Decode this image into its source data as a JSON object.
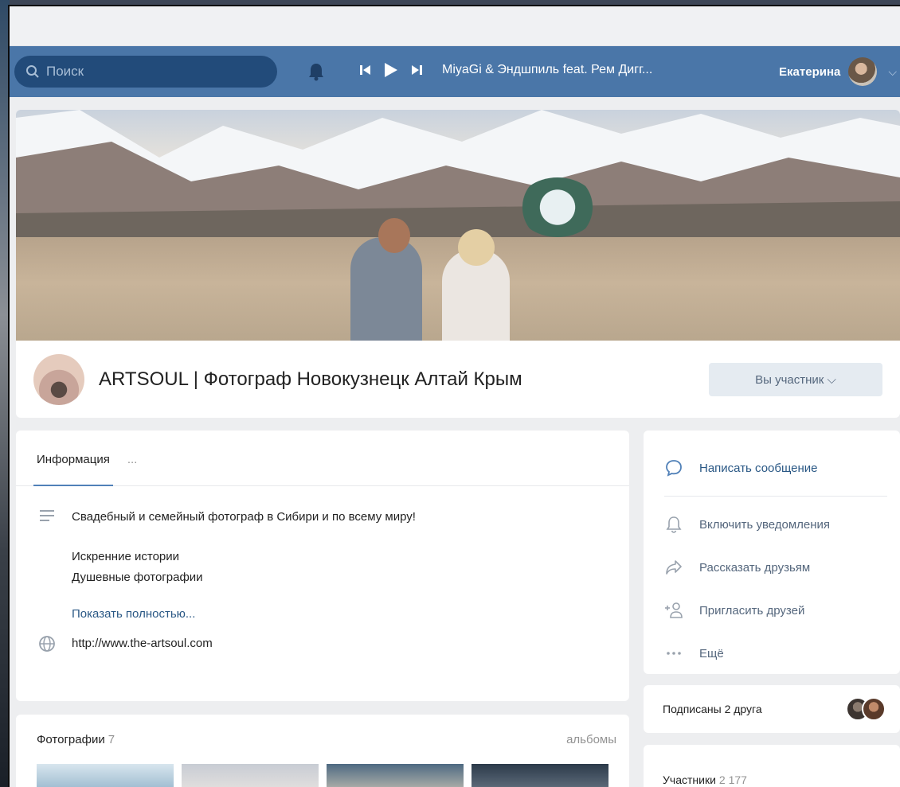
{
  "header": {
    "search_placeholder": "Поиск",
    "track": "MiyaGi & Эндшпиль feat. Рем Дигг...",
    "user_name": "Екатерина"
  },
  "group": {
    "title": "ARTSOUL | Фотограф Новокузнецк Алтай Крым",
    "member_button": "Вы участник ⌵"
  },
  "info": {
    "tabs": [
      {
        "label": "Информация"
      },
      {
        "label": "..."
      }
    ],
    "description": "Свадебный и семейный фотограф в Сибири и по всему миру!",
    "lines": [
      "Искренние истории",
      "Душевные фотографии"
    ],
    "show_more": "Показать полностью...",
    "website": "http://www.the-artsoul.com"
  },
  "photos": {
    "title": "Фотографии",
    "count": "7",
    "albums_link": "альбомы"
  },
  "actions": {
    "items": [
      {
        "label": "Написать сообщение",
        "icon": "message-icon"
      },
      {
        "label": "Включить уведомления",
        "icon": "bell-outline-icon"
      },
      {
        "label": "Рассказать друзьям",
        "icon": "share-icon"
      },
      {
        "label": "Пригласить друзей",
        "icon": "add-friend-icon"
      },
      {
        "label": "Ещё",
        "icon": "more-dots-icon"
      }
    ]
  },
  "subscribed": {
    "label": "Подписаны 2 друга"
  },
  "members": {
    "label": "Участники",
    "count": "2 177"
  },
  "colors": {
    "header_bg": "#4a76a8",
    "link": "#2a5885",
    "page_bg": "#edeef0"
  }
}
